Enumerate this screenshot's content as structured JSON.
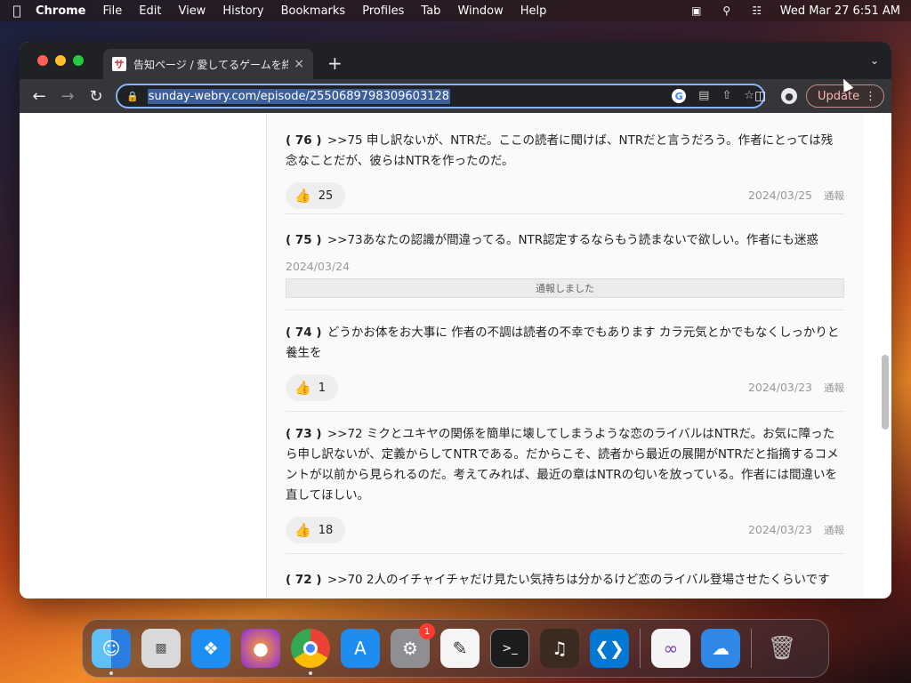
{
  "menubar": {
    "app": "Chrome",
    "items": [
      "File",
      "Edit",
      "View",
      "History",
      "Bookmarks",
      "Profiles",
      "Tab",
      "Window",
      "Help"
    ],
    "datetime": "Wed Mar 27  6:51 AM"
  },
  "tab": {
    "title": "告知ページ / 愛してるゲームを終",
    "favicon": "サ"
  },
  "toolbar": {
    "url": "sunday-webry.com/episode/2550689798309603128",
    "update_label": "Update"
  },
  "comments": [
    {
      "number": "( 76 )",
      "text": ">>75 申し訳ないが、NTRだ。ここの読者に聞けば、NTRだと言うだろう。作者にとっては残念なことだが、彼らはNTRを作ったのだ。",
      "likes": "25",
      "date": "2024/03/25",
      "report": "通報"
    },
    {
      "number": "( 75 )",
      "text": ">>73あなたの認識が間違ってる。NTR認定するならもう読まないで欲しい。作者にも迷惑",
      "date": "2024/03/24",
      "reported_label": "通報しました"
    },
    {
      "number": "( 74 )",
      "text": "どうかお体をお大事に 作者の不調は読者の不幸でもあります カラ元気とかでもなくしっかりと養生を",
      "likes": "1",
      "date": "2024/03/23",
      "report": "通報"
    },
    {
      "number": "( 73 )",
      "text": ">>72 ミクとユキヤの関係を簡単に壊してしまうような恋のライバルはNTRだ。お気に障ったら申し訳ないが、定義からしてNTRである。だからこそ、読者から最近の展開がNTRだと指摘するコメントが以前から見られるのだ。考えてみれば、最近の章はNTRの匂いを放っている。作者には間違いを直してほしい。",
      "likes": "18",
      "date": "2024/03/23",
      "report": "通報"
    },
    {
      "number": "( 72 )",
      "text": ">>70 2人のイチャイチャだけ見たい気持ちは分かるけど恋のライバル登場させたくらいです"
    }
  ],
  "dock": {
    "apps": [
      "finder",
      "launchpad",
      "safari",
      "firefox",
      "chrome",
      "app-store",
      "system-settings",
      "textedit",
      "terminal",
      "garageband",
      "vscode",
      "visual-studio",
      "weather",
      "trash"
    ],
    "settings_badge": "1"
  },
  "colors": {
    "accent": "#8ab4f8",
    "toolbar_bg": "#35363a",
    "tabstrip_bg": "#202124"
  }
}
